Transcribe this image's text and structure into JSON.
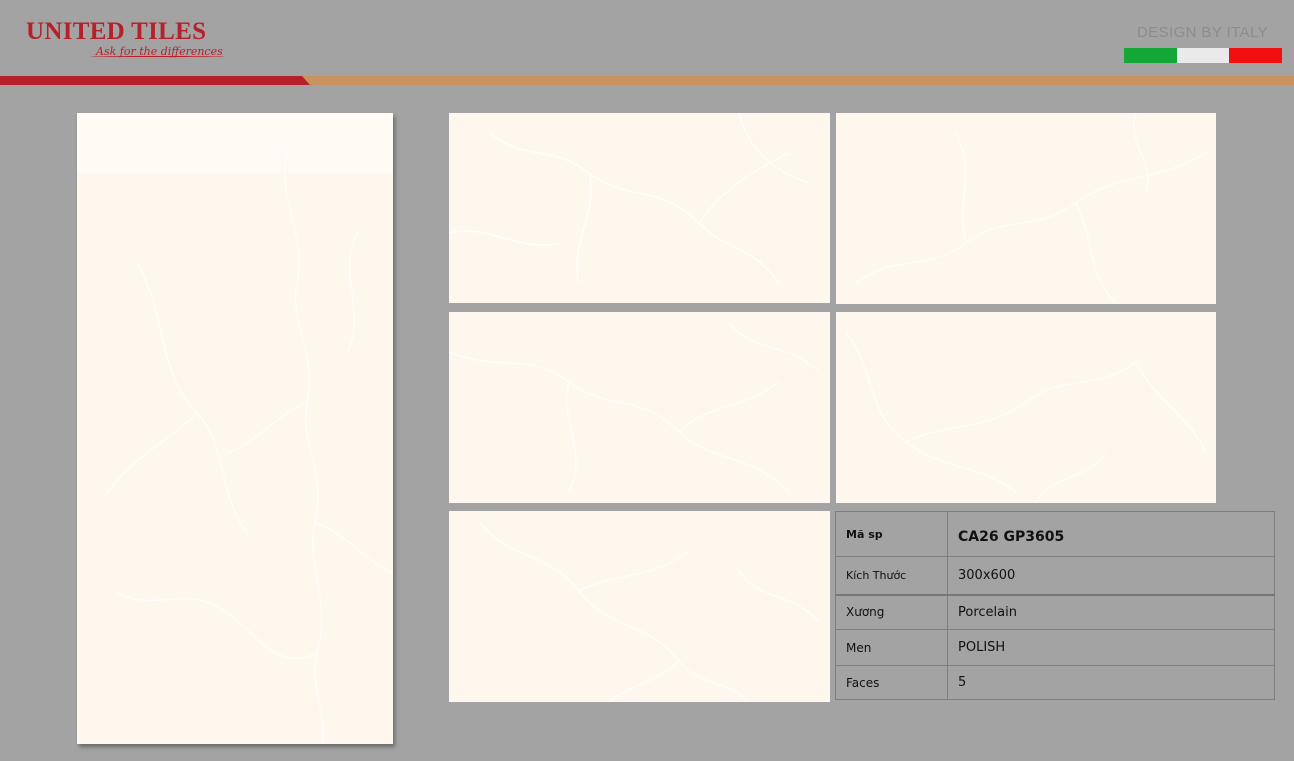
{
  "brand": {
    "name": "UNITED TILES",
    "tagline": "Ask for the differences",
    "color": "#b5202a"
  },
  "header": {
    "design_by": "DESIGN BY ITALY",
    "flag_colors": [
      "#14a637",
      "#eaeaea",
      "#f10f0f"
    ],
    "stripe_colors": [
      "#b5202a",
      "#c8925e"
    ]
  },
  "tile_color": "#fef7ee",
  "spec": {
    "rows": [
      {
        "key": "Mã sp",
        "value": "CA26 GP3605"
      },
      {
        "key": "Kích Thước",
        "value": "300x600"
      },
      {
        "key": "Xương",
        "value": "Porcelain"
      },
      {
        "key": "Men",
        "value": "POLISH"
      },
      {
        "key": "Faces",
        "value": "5"
      }
    ]
  }
}
